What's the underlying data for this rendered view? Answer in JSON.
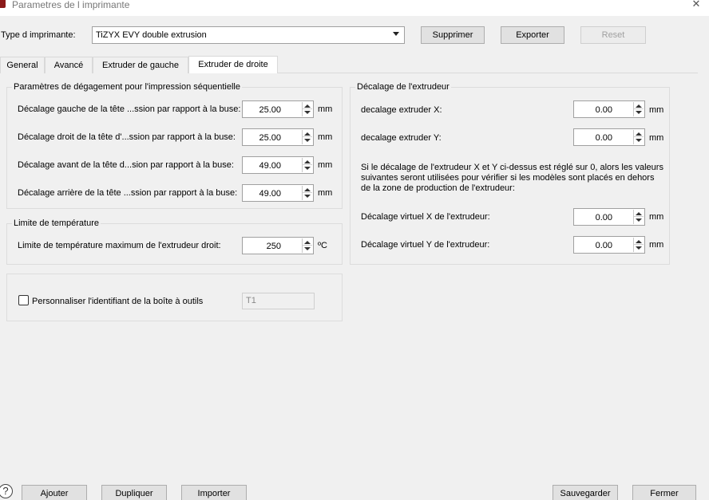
{
  "window": {
    "title": "Parametres de l imprimante",
    "close": "✕"
  },
  "printer": {
    "type_label": "Type d imprimante:",
    "selected": "TiZYX EVY double extrusion",
    "delete_button": "Supprimer",
    "export_button": "Exporter",
    "reset_button": "Reset"
  },
  "tabs": [
    "General",
    "Avancé",
    "Extruder de gauche",
    "Extruder de droite"
  ],
  "active_tab": "Extruder de droite",
  "clearance_group": {
    "title": "Paramètres de dégagement pour l'impression séquentielle",
    "rows": [
      {
        "label": "Décalage gauche de la tête ...ssion par rapport à la buse:",
        "value": "25.00",
        "unit": "mm"
      },
      {
        "label": "Décalage droit de la tête d'...ssion par rapport à la buse:",
        "value": "25.00",
        "unit": "mm"
      },
      {
        "label": "Décalage avant de la tête d...sion par rapport à la buse:",
        "value": "49.00",
        "unit": "mm"
      },
      {
        "label": "Décalage arrière de la tête ...ssion par rapport à la buse:",
        "value": "49.00",
        "unit": "mm"
      }
    ]
  },
  "temperature_group": {
    "title": "Limite de température",
    "label": "Limite de température maximum de l'extrudeur droit:",
    "value": "250",
    "unit": "ºC"
  },
  "toolhead": {
    "checkbox_label": "Personnaliser l'identifiant de la boîte à outils",
    "checked": false,
    "id_value": "T1"
  },
  "offset_group": {
    "title": "Décalage de l'extrudeur",
    "x_label": "decalage extruder X:",
    "x_value": "0.00",
    "y_label": "decalage extruder Y:",
    "y_value": "0.00",
    "unit": "mm",
    "info": "Si le décalage de l'extrudeur X et Y ci-dessus est réglé sur 0, alors les valeurs suivantes seront utilisées pour vérifier si les modèles sont placés en dehors de la zone de production de l'extrudeur:",
    "vx_label": "Décalage virtuel X de l'extrudeur:",
    "vx_value": "0.00",
    "vy_label": "Décalage virtuel Y de l'extrudeur:",
    "vy_value": "0.00"
  },
  "footer": {
    "help": "?",
    "add": "Ajouter",
    "duplicate": "Dupliquer",
    "import": "Importer",
    "save": "Sauvegarder",
    "close": "Fermer"
  }
}
